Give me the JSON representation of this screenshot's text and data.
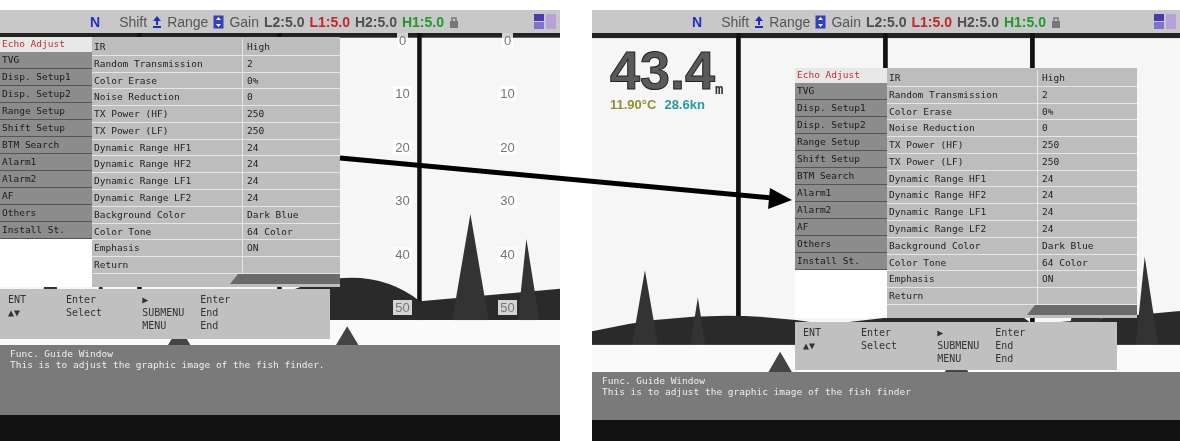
{
  "panels": [
    {
      "kind": "left",
      "top_bar": {
        "mode": "N",
        "shift": "Shift",
        "range": "Range",
        "gain": "Gain",
        "gains": [
          {
            "text": "L2:5.0",
            "color": "#505050"
          },
          {
            "text": "L1:5.0",
            "color": "#c02828"
          },
          {
            "text": "H2:5.0",
            "color": "#505050"
          },
          {
            "text": "H1:5.0",
            "color": "#1f9a2c"
          }
        ]
      },
      "scales": [
        [
          "0",
          "10",
          "20",
          "30",
          "40",
          "50"
        ],
        [
          "0",
          "10",
          "20",
          "30",
          "40",
          "50"
        ]
      ],
      "menu": {
        "title": "Echo Adjust",
        "submenu": [
          "TVG",
          "Disp. Setup1",
          "Disp. Setup2",
          "Range Setup",
          "Shift Setup",
          "BTM Search",
          "Alarm1",
          "Alarm2",
          "AF",
          "Others",
          "Install St."
        ],
        "rows": [
          {
            "label": "IR",
            "value": "High"
          },
          {
            "label": "Random Transmission",
            "value": "2"
          },
          {
            "label": "Color Erase",
            "value": "0%"
          },
          {
            "label": "Noise Reduction",
            "value": "0"
          },
          {
            "label": "TX Power (HF)",
            "value": "250"
          },
          {
            "label": "TX Power (LF)",
            "value": "250"
          },
          {
            "label": "Dynamic Range HF1",
            "value": "24"
          },
          {
            "label": "Dynamic Range HF2",
            "value": "24"
          },
          {
            "label": "Dynamic Range LF1",
            "value": "24"
          },
          {
            "label": "Dynamic Range LF2",
            "value": "24"
          },
          {
            "label": "Background Color",
            "value": "Dark Blue"
          },
          {
            "label": "Color Tone",
            "value": "64 Color"
          },
          {
            "label": "Emphasis",
            "value": "ON"
          },
          {
            "label": "Return",
            "value": ""
          }
        ]
      },
      "keys": [
        [
          {
            "key": "ENT",
            "action": "Enter"
          },
          {
            "key": "▲▼",
            "action": "Select"
          }
        ],
        [
          {
            "key": "▶",
            "action": "Enter"
          },
          {
            "key": "SUBMENU",
            "action": "End"
          },
          {
            "key": "MENU",
            "action": "End"
          }
        ]
      ],
      "guide": {
        "title": "Func. Guide Window",
        "text": "This is to adjust the graphic image of the fish finder."
      }
    },
    {
      "kind": "right",
      "top_bar": {
        "mode": "N",
        "shift": "Shift",
        "range": "Range",
        "gain": "Gain",
        "gains": [
          {
            "text": "L2:5.0",
            "color": "#505050"
          },
          {
            "text": "L1:5.0",
            "color": "#c02828"
          },
          {
            "text": "H2:5.0",
            "color": "#505050"
          },
          {
            "text": "H1:5.0",
            "color": "#1f9a2c"
          }
        ]
      },
      "readout": {
        "depth": "43.4",
        "unit": "m",
        "temperature": "11.90°C",
        "speed": "28.6kn"
      },
      "menu": {
        "title": "Echo Adjust",
        "submenu": [
          "TVG",
          "Disp. Setup1",
          "Disp. Setup2",
          "Range Setup",
          "Shift Setup",
          "BTM Search",
          "Alarm1",
          "Alarm2",
          "AF",
          "Others",
          "Install St."
        ],
        "rows": [
          {
            "label": "IR",
            "value": "High"
          },
          {
            "label": "Random Transmission",
            "value": "2"
          },
          {
            "label": "Color Erase",
            "value": "0%"
          },
          {
            "label": "Noise Reduction",
            "value": "0"
          },
          {
            "label": "TX Power (HF)",
            "value": "250"
          },
          {
            "label": "TX Power (LF)",
            "value": "250"
          },
          {
            "label": "Dynamic Range HF1",
            "value": "24"
          },
          {
            "label": "Dynamic Range HF2",
            "value": "24"
          },
          {
            "label": "Dynamic Range LF1",
            "value": "24"
          },
          {
            "label": "Dynamic Range LF2",
            "value": "24"
          },
          {
            "label": "Background Color",
            "value": "Dark Blue"
          },
          {
            "label": "Color Tone",
            "value": "64 Color"
          },
          {
            "label": "Emphasis",
            "value": "ON"
          },
          {
            "label": "Return",
            "value": ""
          }
        ]
      },
      "keys": [
        [
          {
            "key": "ENT",
            "action": "Enter"
          },
          {
            "key": "▲▼",
            "action": "Select"
          }
        ],
        [
          {
            "key": "▶",
            "action": "Enter"
          },
          {
            "key": "SUBMENU",
            "action": "End"
          },
          {
            "key": "MENU",
            "action": "End"
          }
        ]
      ],
      "guide": {
        "title": "Func. Guide Window",
        "text": "This is to adjust the graphic image of the fish finder"
      }
    }
  ]
}
